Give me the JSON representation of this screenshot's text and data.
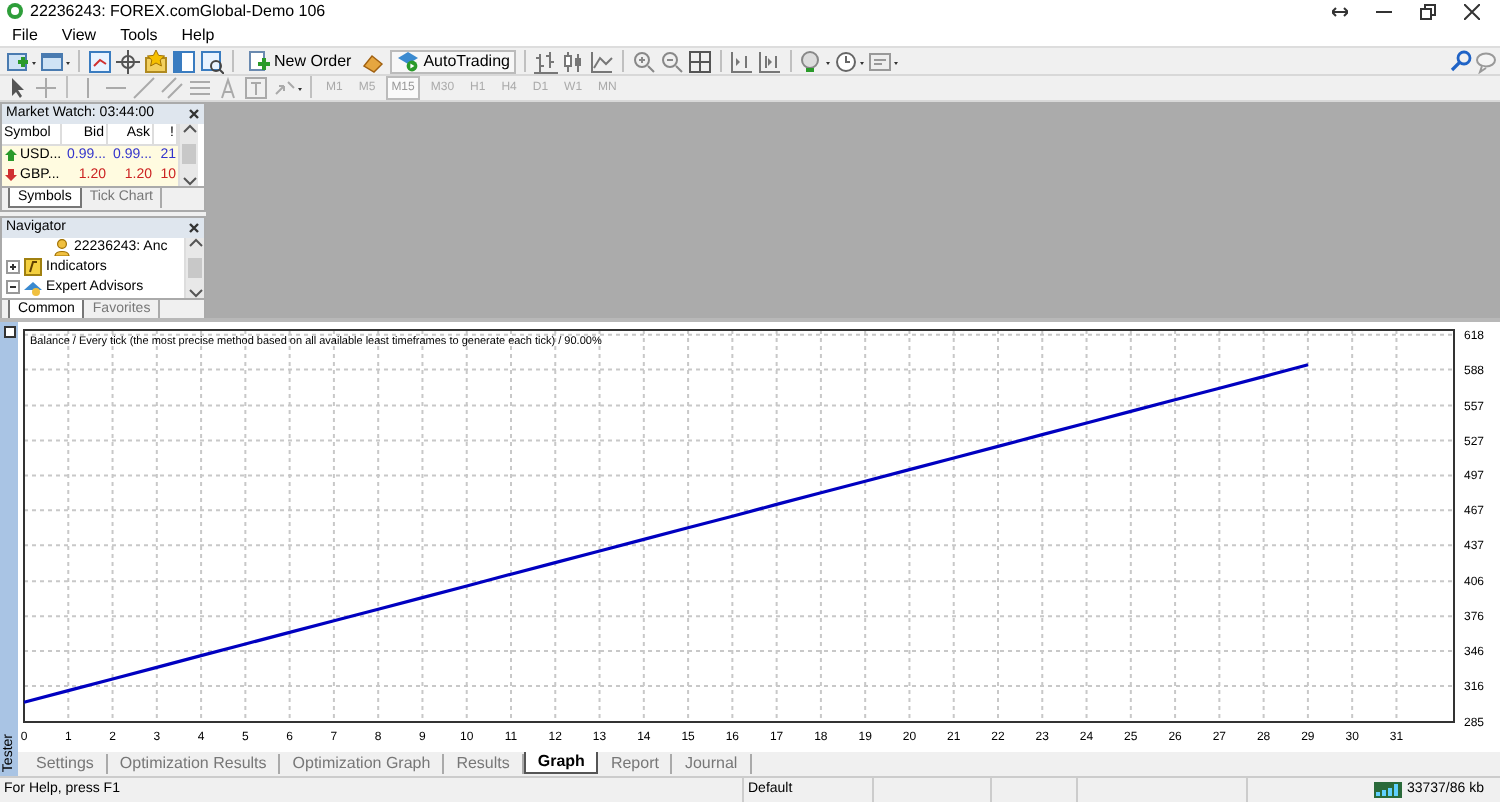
{
  "window": {
    "title": "22236243: FOREX.comGlobal-Demo 106"
  },
  "menu": [
    "File",
    "View",
    "Tools",
    "Help"
  ],
  "toolbar": {
    "new_order": "New Order",
    "autotrading": "AutoTrading"
  },
  "timeframes": [
    {
      "label": "M1",
      "selected": false
    },
    {
      "label": "M5",
      "selected": false
    },
    {
      "label": "M15",
      "selected": true
    },
    {
      "label": "M30",
      "selected": false
    },
    {
      "label": "H1",
      "selected": false
    },
    {
      "label": "H4",
      "selected": false
    },
    {
      "label": "D1",
      "selected": false
    },
    {
      "label": "W1",
      "selected": false
    },
    {
      "label": "MN",
      "selected": false
    }
  ],
  "market_watch": {
    "title": "Market Watch: 03:44:00",
    "columns": [
      "Symbol",
      "Bid",
      "Ask",
      "!"
    ],
    "rows": [
      {
        "symbol": "USD...",
        "bid": "0.99...",
        "ask": "0.99...",
        "column_4": "21",
        "kind": "up"
      },
      {
        "symbol": "GBP...",
        "bid": "1.20",
        "ask": "1.20",
        "column_4": "10",
        "kind": "down"
      }
    ],
    "tabs": [
      {
        "label": "Symbols",
        "selected": true
      },
      {
        "label": "Tick Chart",
        "selected": false
      }
    ]
  },
  "navigator": {
    "title": "Navigator",
    "items": [
      {
        "label": "22236243: Anc",
        "kind": "account"
      },
      {
        "label": "Indicators",
        "kind": "folder",
        "expanded": false
      },
      {
        "label": "Expert Advisors",
        "kind": "folder",
        "expanded": true
      }
    ],
    "tabs": [
      {
        "label": "Common",
        "selected": true
      },
      {
        "label": "Favorites",
        "selected": false
      }
    ]
  },
  "tester": {
    "side_label": "Tester",
    "chart_data": {
      "type": "line",
      "title": "Balance / Every tick (the most precise method based on all available least timeframes to generate each tick) / 90.00%",
      "x": [
        0,
        1,
        2,
        3,
        4,
        5,
        6,
        7,
        8,
        9,
        10,
        11,
        12,
        13,
        14,
        15,
        16,
        17,
        18,
        19,
        20,
        21,
        22,
        23,
        24,
        25,
        26,
        27,
        28,
        29
      ],
      "grid": true,
      "series": [
        {
          "color": "#0000c0",
          "values": [
            302,
            312,
            322,
            332,
            342,
            352,
            362,
            372,
            382,
            392,
            402,
            412,
            422,
            432,
            442,
            452,
            462,
            472,
            482,
            492,
            502,
            512,
            522,
            532,
            542,
            552,
            562,
            572,
            582,
            592
          ]
        }
      ],
      "xlim": [
        0,
        32.3
      ],
      "ylim": [
        285,
        622
      ],
      "xticks": [
        0,
        1,
        2,
        3,
        4,
        5,
        6,
        7,
        8,
        9,
        10,
        11,
        12,
        13,
        14,
        15,
        16,
        17,
        18,
        19,
        20,
        21,
        22,
        23,
        24,
        25,
        26,
        27,
        28,
        29,
        30,
        31
      ],
      "yticks": [
        285,
        316,
        346,
        376,
        406,
        437,
        467,
        497,
        527,
        557,
        588,
        618
      ]
    },
    "tabs": [
      {
        "label": "Settings",
        "selected": false
      },
      {
        "label": "Optimization Results",
        "selected": false
      },
      {
        "label": "Optimization Graph",
        "selected": false
      },
      {
        "label": "Results",
        "selected": false
      },
      {
        "label": "Graph",
        "selected": true
      },
      {
        "label": "Report",
        "selected": false
      },
      {
        "label": "Journal",
        "selected": false
      }
    ]
  },
  "status_bar": {
    "help": "For Help, press F1",
    "profile": "Default",
    "memory": "33737/86 kb"
  }
}
